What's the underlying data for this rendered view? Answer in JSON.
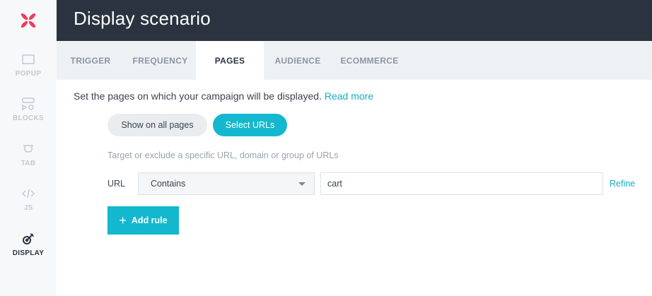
{
  "header": {
    "title": "Display scenario"
  },
  "sidebar": {
    "items": [
      {
        "id": "popup",
        "label": "POPUP",
        "icon": "popup-icon",
        "active": false
      },
      {
        "id": "blocks",
        "label": "BLOCKS",
        "icon": "blocks-icon",
        "active": false
      },
      {
        "id": "tab",
        "label": "TAB",
        "icon": "tab-icon",
        "active": false
      },
      {
        "id": "js",
        "label": "JS",
        "icon": "code-icon",
        "active": false
      },
      {
        "id": "display",
        "label": "DISPLAY",
        "icon": "target-icon",
        "active": true
      }
    ]
  },
  "tabs": [
    {
      "label": "TRIGGER",
      "active": false
    },
    {
      "label": "FREQUENCY",
      "active": false
    },
    {
      "label": "PAGES",
      "active": true
    },
    {
      "label": "AUDIENCE",
      "active": false
    },
    {
      "label": "ECOMMERCE",
      "active": false
    }
  ],
  "pages": {
    "intro": "Set the pages on which your campaign will be displayed.",
    "read_more": "Read more",
    "options": {
      "all_pages": "Show on all pages",
      "select_urls": "Select URLs",
      "selected": "select_urls"
    },
    "hint": "Target or exclude a specific URL, domain or group of URLs",
    "rule": {
      "label": "URL",
      "operator": "Contains",
      "value": "cart",
      "refine": "Refine"
    },
    "add_rule": "Add rule"
  },
  "colors": {
    "header_bg": "#2b3340",
    "accent": "#13b8ce",
    "logo": "#ee3e5a",
    "sidebar_bg": "#f7f8f9",
    "tabs_bg": "#eef1f4"
  }
}
